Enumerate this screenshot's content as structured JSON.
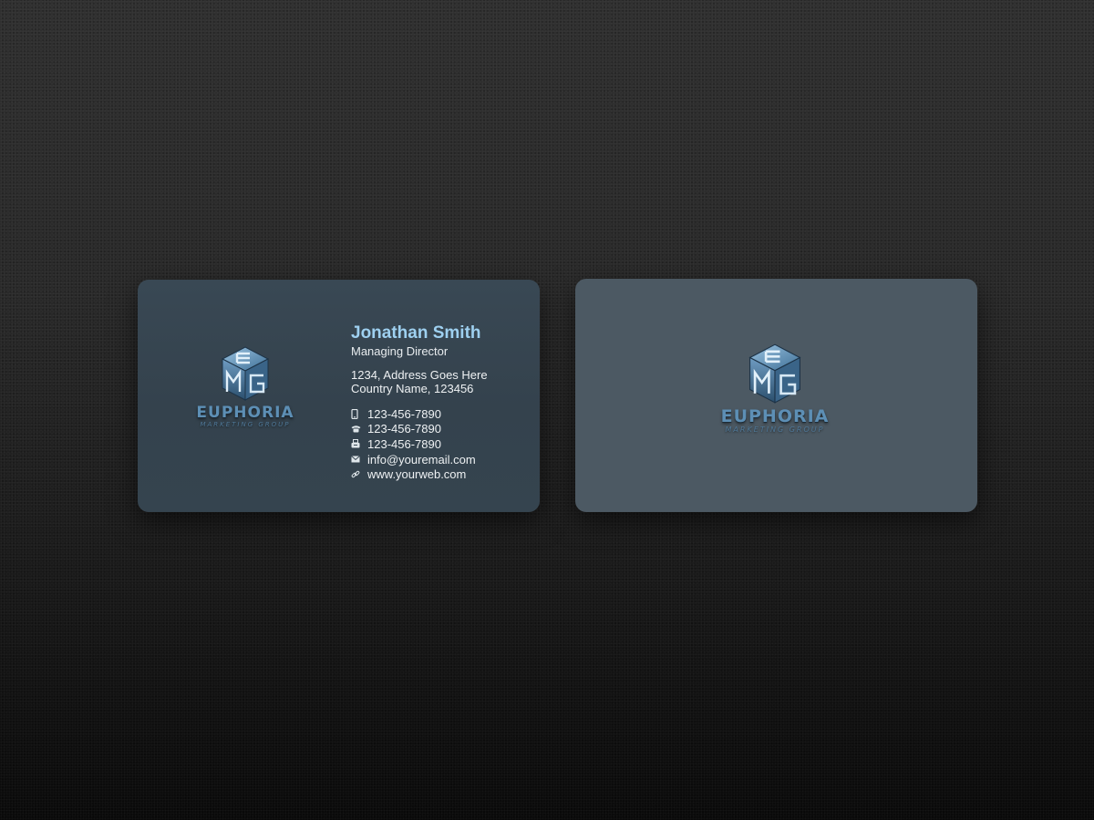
{
  "front_card": {
    "name": "Jonathan Smith",
    "title": "Managing Director",
    "address_line1": "1234, Address Goes Here",
    "address_line2": "Country Name, 123456",
    "contacts": [
      {
        "icon": "mobile-phone-icon",
        "text": "123-456-7890"
      },
      {
        "icon": "telephone-icon",
        "text": "123-456-7890"
      },
      {
        "icon": "fax-icon",
        "text": "123-456-7890"
      },
      {
        "icon": "email-icon",
        "text": "info@youremail.com"
      },
      {
        "icon": "link-icon",
        "text": "www.yourweb.com"
      }
    ]
  },
  "logo": {
    "monogram": "EMG",
    "name": "EUPHORIA",
    "subtitle": "MARKETING GROUP"
  },
  "colors": {
    "background": "#2a2a2a",
    "front_card": "#374651",
    "back_card": "#4c5963",
    "name_accent": "#9ed0f0",
    "logo_blue": "#5d8fb5"
  }
}
